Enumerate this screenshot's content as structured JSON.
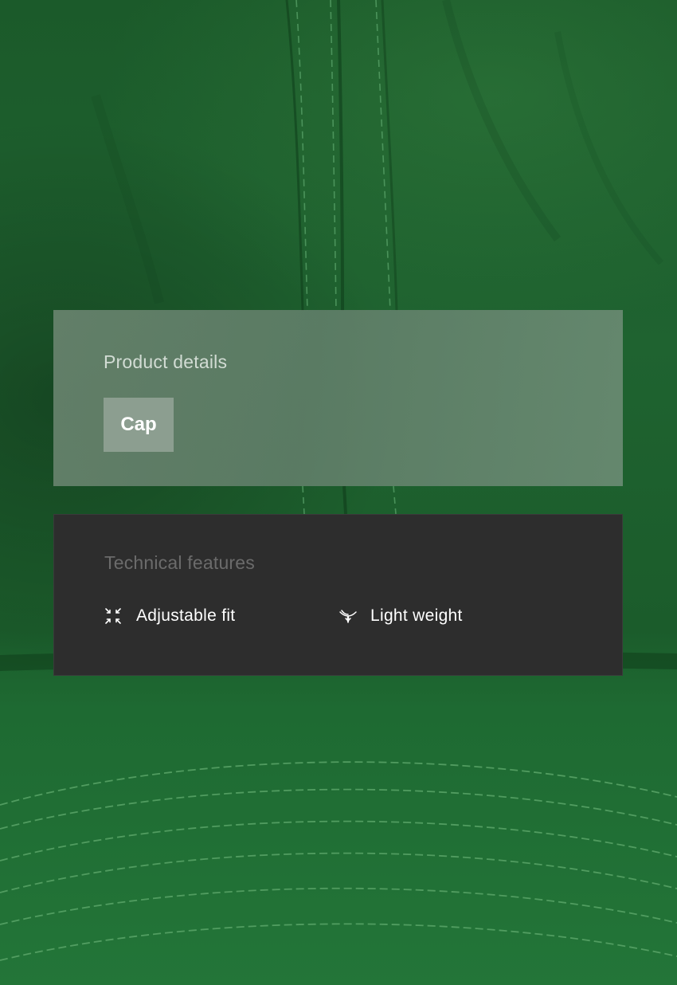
{
  "product_details": {
    "title": "Product details",
    "tag": "Cap"
  },
  "technical_features": {
    "title": "Technical features",
    "items": [
      {
        "icon": "adjustable-fit-icon",
        "label": "Adjustable fit"
      },
      {
        "icon": "light-weight-icon",
        "label": "Light weight"
      }
    ]
  },
  "colors": {
    "fabric": "#1f6b31",
    "details_card": "#6e8773",
    "tag": "#8c9e90",
    "features_card": "#2d2d2d",
    "text_light": "#ffffff",
    "text_muted": "#6b6b6b"
  }
}
